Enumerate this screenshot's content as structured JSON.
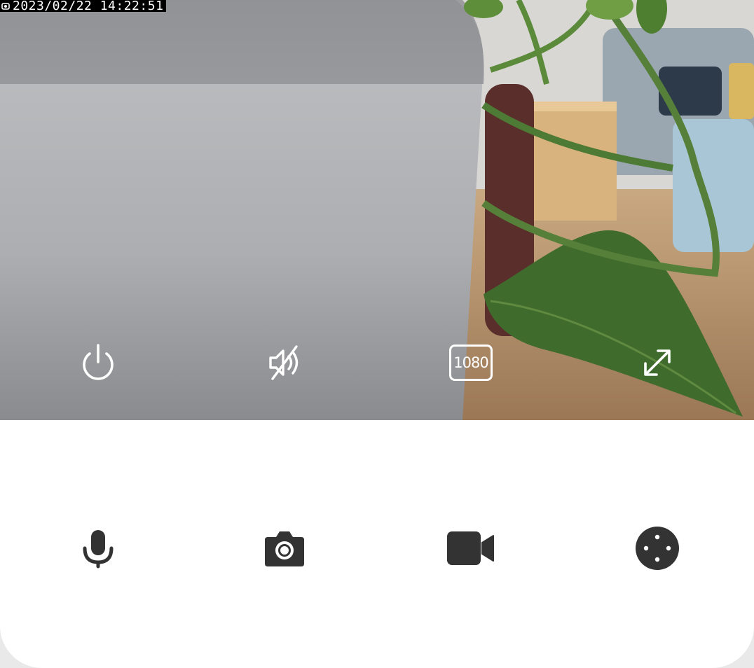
{
  "feed": {
    "timestamp": "2023/02/22  14:22:51"
  },
  "feed_controls": [
    {
      "name": "power-icon"
    },
    {
      "name": "sound-off-icon"
    },
    {
      "name": "resolution-icon",
      "label": "1080"
    },
    {
      "name": "fullscreen-icon"
    }
  ],
  "actions": [
    {
      "name": "microphone-icon"
    },
    {
      "name": "camera-icon"
    },
    {
      "name": "video-camera-icon"
    },
    {
      "name": "joystick-icon"
    }
  ],
  "colors": {
    "icon_light": "#ffffff",
    "icon_dark": "#333333",
    "panel_bg": "#ffffff"
  }
}
